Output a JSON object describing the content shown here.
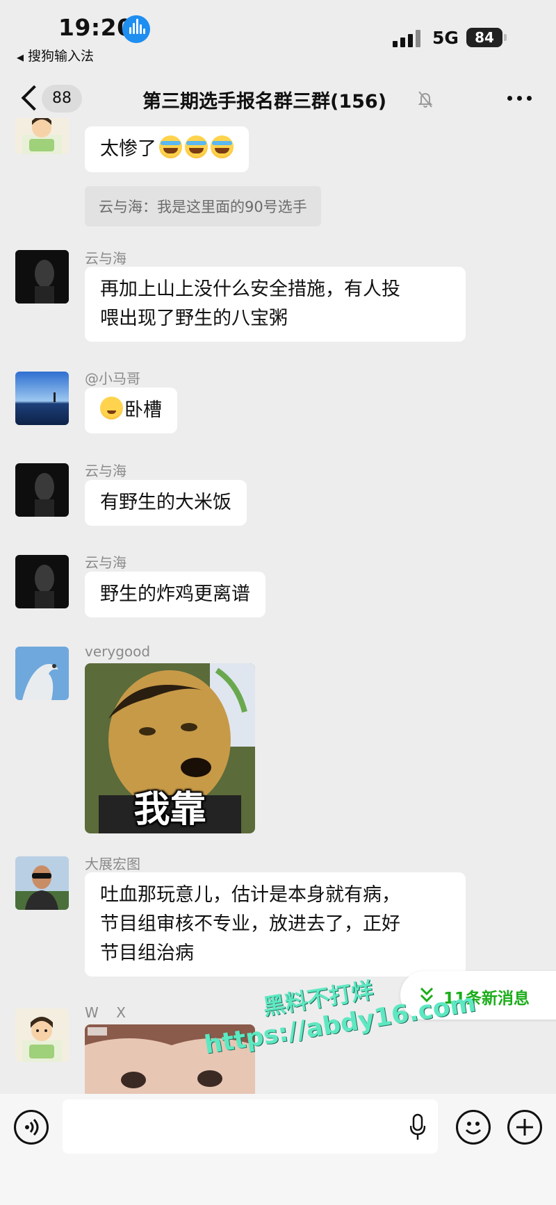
{
  "status_bar": {
    "time": "19:20",
    "back_app": "搜狗输入法",
    "network": "5G",
    "battery": "84"
  },
  "nav": {
    "unread_count": "88",
    "title": "第三期选手报名群三群(156)"
  },
  "messages": [
    {
      "type": "text",
      "sender": "",
      "text": "太惨了",
      "emoji": "cry-laugh x3"
    },
    {
      "type": "quote",
      "text": "云与海：我是这里面的90号选手"
    },
    {
      "type": "text",
      "sender": "云与海",
      "lines": [
        "再加上山上没什么安全措施，有人投",
        "喂出现了野生的八宝粥"
      ]
    },
    {
      "type": "text",
      "sender": "@小马哥",
      "text": "卧槽",
      "emoji": "smile"
    },
    {
      "type": "text",
      "sender": "云与海",
      "text": "有野生的大米饭"
    },
    {
      "type": "text",
      "sender": "云与海",
      "text": "野生的炸鸡更离谱"
    },
    {
      "type": "sticker",
      "sender": "verygood",
      "caption": "我靠"
    },
    {
      "type": "text",
      "sender": "大展宏图",
      "lines": [
        "吐血那玩意儿，估计是本身就有病，",
        "节目组审核不专业，放进去了，正好",
        "节目组治病"
      ]
    },
    {
      "type": "sticker",
      "sender": "W    X",
      "caption": ""
    }
  ],
  "new_messages": "11条新消息",
  "watermark": {
    "line1": "黑料不打烊",
    "line2": "https://abdy16.com"
  },
  "colors": {
    "background": "#ededed",
    "accent_green": "#1aad19",
    "voice_blue": "#1e8ef1",
    "watermark": "#5ee8c2"
  },
  "icons": [
    "voice-input-icon",
    "microphone-icon",
    "emoji-icon",
    "plus-icon",
    "more-icon",
    "mute-bell-icon",
    "back-chevron-icon"
  ]
}
